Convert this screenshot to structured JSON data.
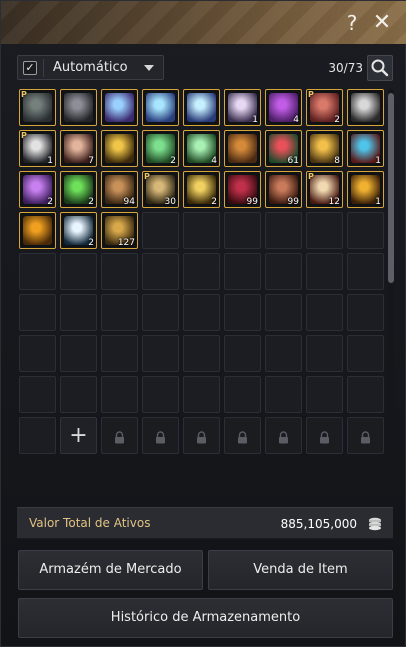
{
  "window": {
    "help_label": "?",
    "close_label": "✕"
  },
  "toolbar": {
    "mode_checked": true,
    "mode_label": "Automático",
    "capacity": "30/73"
  },
  "items": [
    {
      "name": "dark-hat",
      "qty": "",
      "p": true,
      "colors": [
        "#2a2e31",
        "#75807c"
      ]
    },
    {
      "name": "pickaxe-tool",
      "qty": "",
      "p": false,
      "colors": [
        "#232428",
        "#8c8f96"
      ]
    },
    {
      "name": "blue-crystal",
      "qty": "",
      "p": false,
      "colors": [
        "#3b2a6e",
        "#9ad0ff"
      ]
    },
    {
      "name": "blue-crystal",
      "qty": "",
      "p": false,
      "colors": [
        "#2a3f7e",
        "#a8e6ff"
      ]
    },
    {
      "name": "blue-crystal",
      "qty": "",
      "p": false,
      "colors": [
        "#283a78",
        "#c6f0ff"
      ]
    },
    {
      "name": "scroll-paper",
      "qty": "1",
      "p": false,
      "colors": [
        "#3a2f4e",
        "#e6d8f2"
      ]
    },
    {
      "name": "purple-book",
      "qty": "4",
      "p": false,
      "colors": [
        "#4b1e66",
        "#c05ce6"
      ]
    },
    {
      "name": "red-box",
      "qty": "2",
      "p": true,
      "colors": [
        "#5e1f1f",
        "#d8796a"
      ]
    },
    {
      "name": "silver-orb",
      "qty": "",
      "p": false,
      "colors": [
        "#2a2a2a",
        "#d8d8d8"
      ]
    },
    {
      "name": "white-tree",
      "qty": "1",
      "p": true,
      "colors": [
        "#222327",
        "#e2e2e2"
      ]
    },
    {
      "name": "coffee-cup",
      "qty": "7",
      "p": false,
      "colors": [
        "#3a1e1a",
        "#e2b49b"
      ]
    },
    {
      "name": "gold-gem",
      "qty": "",
      "p": false,
      "colors": [
        "#3d2a0a",
        "#f0c548"
      ]
    },
    {
      "name": "green-gift",
      "qty": "2",
      "p": false,
      "colors": [
        "#1f4a24",
        "#7ee08f"
      ]
    },
    {
      "name": "green-gift",
      "qty": "4",
      "p": false,
      "colors": [
        "#1f4a24",
        "#a8f0b4"
      ]
    },
    {
      "name": "treasure-chest",
      "qty": "",
      "p": false,
      "colors": [
        "#4a2a12",
        "#d48a3a"
      ]
    },
    {
      "name": "rainbow-orb",
      "qty": "61",
      "p": false,
      "colors": [
        "#1f4a2a",
        "#e8505a"
      ]
    },
    {
      "name": "gold-shell",
      "qty": "8",
      "p": false,
      "colors": [
        "#4a3412",
        "#f2c04a"
      ]
    },
    {
      "name": "red-card",
      "qty": "1",
      "p": false,
      "colors": [
        "#5a1a1a",
        "#4fc3e8"
      ]
    },
    {
      "name": "purple-chest",
      "qty": "2",
      "p": false,
      "colors": [
        "#3e1f5e",
        "#c880f0"
      ]
    },
    {
      "name": "green-potion",
      "qty": "2",
      "p": false,
      "colors": [
        "#1a3a1a",
        "#6ee05a"
      ]
    },
    {
      "name": "brown-scroll",
      "qty": "94",
      "p": false,
      "colors": [
        "#3a2612",
        "#c8915a"
      ]
    },
    {
      "name": "gold-bottle",
      "qty": "30",
      "p": true,
      "colors": [
        "#2e2614",
        "#d8b878"
      ]
    },
    {
      "name": "gold-crystal",
      "qty": "2",
      "p": false,
      "colors": [
        "#3a2a08",
        "#f0d060"
      ]
    },
    {
      "name": "red-flower",
      "qty": "99",
      "p": false,
      "colors": [
        "#3a0c12",
        "#c0304a"
      ]
    },
    {
      "name": "copper-coin",
      "qty": "99",
      "p": false,
      "colors": [
        "#3a1a10",
        "#c87a5a"
      ]
    },
    {
      "name": "red-letter",
      "qty": "12",
      "p": true,
      "colors": [
        "#4a1a12",
        "#f0d8b0"
      ]
    },
    {
      "name": "fire-gem",
      "qty": "1",
      "p": false,
      "colors": [
        "#3a2008",
        "#f0b030"
      ]
    },
    {
      "name": "orange-cloak",
      "qty": "",
      "p": false,
      "colors": [
        "#4a2a08",
        "#f0a020"
      ]
    },
    {
      "name": "blue-vial",
      "qty": "2",
      "p": false,
      "colors": [
        "#142a3a",
        "#e8f4ff"
      ]
    },
    {
      "name": "gold-coin",
      "qty": "127",
      "p": false,
      "colors": [
        "#3a2a10",
        "#d8a84a"
      ]
    }
  ],
  "grid": {
    "total_slots": 81,
    "unlocked_slots": 73,
    "add_slot_icon": "plus-icon",
    "lock_icon": "lock-icon"
  },
  "assets": {
    "label": "Valor Total de Ativos",
    "value": "885,105,000"
  },
  "buttons": {
    "market": "Armazém de Mercado",
    "sell": "Venda de Item",
    "history": "Histórico de Armazenamento"
  }
}
